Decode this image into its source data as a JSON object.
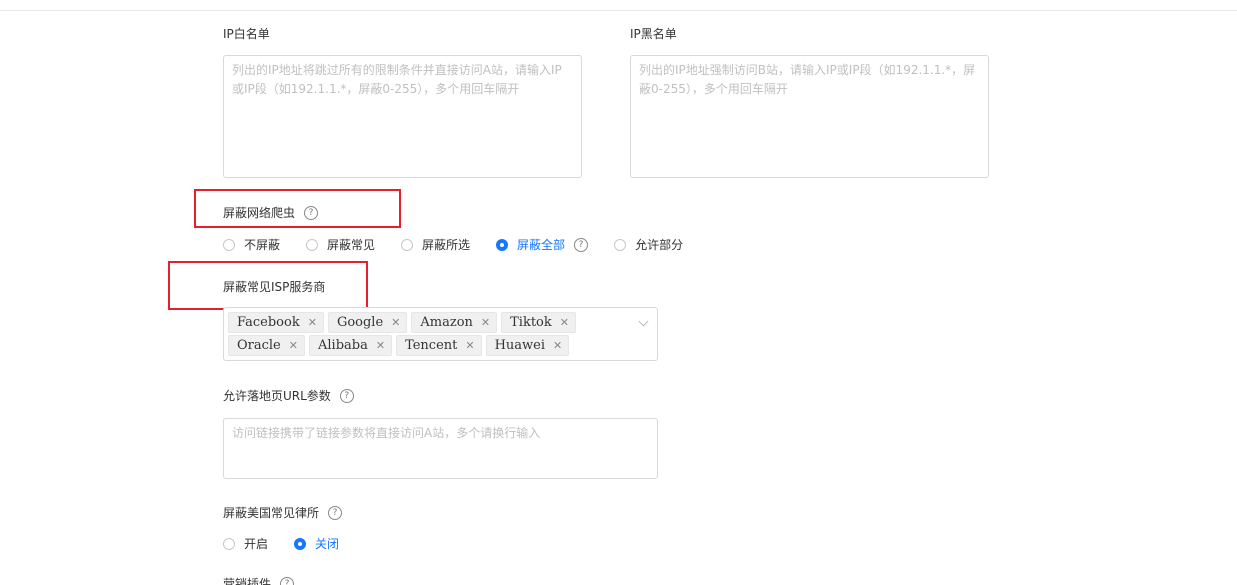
{
  "ip_whitelist": {
    "label": "IP白名单",
    "placeholder": "列出的IP地址将跳过所有的限制条件并直接访问A站，请输入IP或IP段（如192.1.1.*，屏蔽0-255），多个用回车隔开"
  },
  "ip_blacklist": {
    "label": "IP黑名单",
    "placeholder": "列出的IP地址强制访问B站，请输入IP或IP段（如192.1.1.*，屏蔽0-255），多个用回车隔开"
  },
  "block_crawlers": {
    "label": "屏蔽网络爬虫",
    "options": [
      "不屏蔽",
      "屏蔽常见",
      "屏蔽所选",
      "屏蔽全部",
      "允许部分"
    ],
    "selected": "屏蔽全部"
  },
  "block_isp": {
    "label": "屏蔽常见ISP服务商",
    "tags": [
      "Facebook",
      "Google",
      "Amazon",
      "Tiktok",
      "Oracle",
      "Alibaba",
      "Tencent",
      "Huawei"
    ],
    "remove_glyph": "✕"
  },
  "landing_url_params": {
    "label": "允许落地页URL参数",
    "placeholder": "访问链接携带了链接参数将直接访问A站，多个请换行输入"
  },
  "block_us_law_firms": {
    "label": "屏蔽美国常见律所",
    "options": [
      "开启",
      "关闭"
    ],
    "selected": "关闭"
  },
  "next_section": {
    "label": "营销插件"
  },
  "help_glyph": "?",
  "colors": {
    "accent": "#1677ff",
    "highlight_box": "#e3202b"
  }
}
